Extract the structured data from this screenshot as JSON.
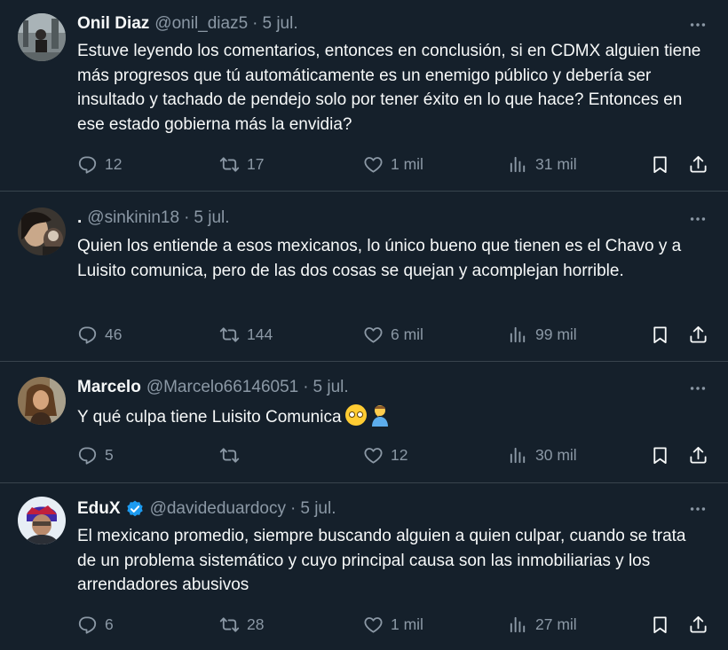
{
  "tweets": [
    {
      "name": "Onil Diaz",
      "handle": "@onil_diaz5",
      "separator": "·",
      "date": "5 jul.",
      "verified": false,
      "text": "Estuve leyendo los comentarios, entonces en conclusión, si en CDMX alguien tiene más progresos que tú automáticamente es un enemigo público y debería ser insultado y tachado de pendejo solo por tener éxito en lo que hace?  Entonces en ese estado gobierna más la envidia?",
      "replies": "12",
      "retweets": "17",
      "likes": "1 mil",
      "views": "31 mil"
    },
    {
      "name": ".",
      "handle": "@sinkinin18",
      "separator": "·",
      "date": "5 jul.",
      "verified": false,
      "text": "Quien los entiende a esos mexicanos, lo único bueno que tienen es el Chavo y a Luisito comunica, pero de las dos cosas se quejan y acomplejan horrible.",
      "replies": "46",
      "retweets": "144",
      "likes": "6 mil",
      "views": "99 mil"
    },
    {
      "name": "Marcelo",
      "handle": "@Marcelo66146051",
      "separator": "·",
      "date": "5 jul.",
      "verified": false,
      "text": "Y qué culpa tiene Luisito Comunica",
      "emojis": [
        "eye-roll-face",
        "person-facepalming"
      ],
      "replies": "5",
      "retweets": "",
      "likes": "12",
      "views": "30 mil"
    },
    {
      "name": "EduX",
      "handle": "@davideduardocy",
      "separator": "·",
      "date": "5 jul.",
      "verified": true,
      "text": "El mexicano promedio, siempre buscando alguien a quien culpar, cuando se trata de un problema sistemático y cuyo principal causa son las inmobiliarias y los arrendadores abusivos",
      "replies": "6",
      "retweets": "28",
      "likes": "1 mil",
      "views": "27 mil"
    }
  ],
  "colors": {
    "background": "#15202b",
    "text": "#f7f9f9",
    "secondary": "#8b98a5",
    "divider": "#38444d",
    "verified": "#1d9bf0"
  },
  "icons": [
    "more-icon",
    "reply-icon",
    "retweet-icon",
    "like-icon",
    "views-icon",
    "bookmark-icon",
    "share-icon",
    "verified-badge-icon"
  ]
}
